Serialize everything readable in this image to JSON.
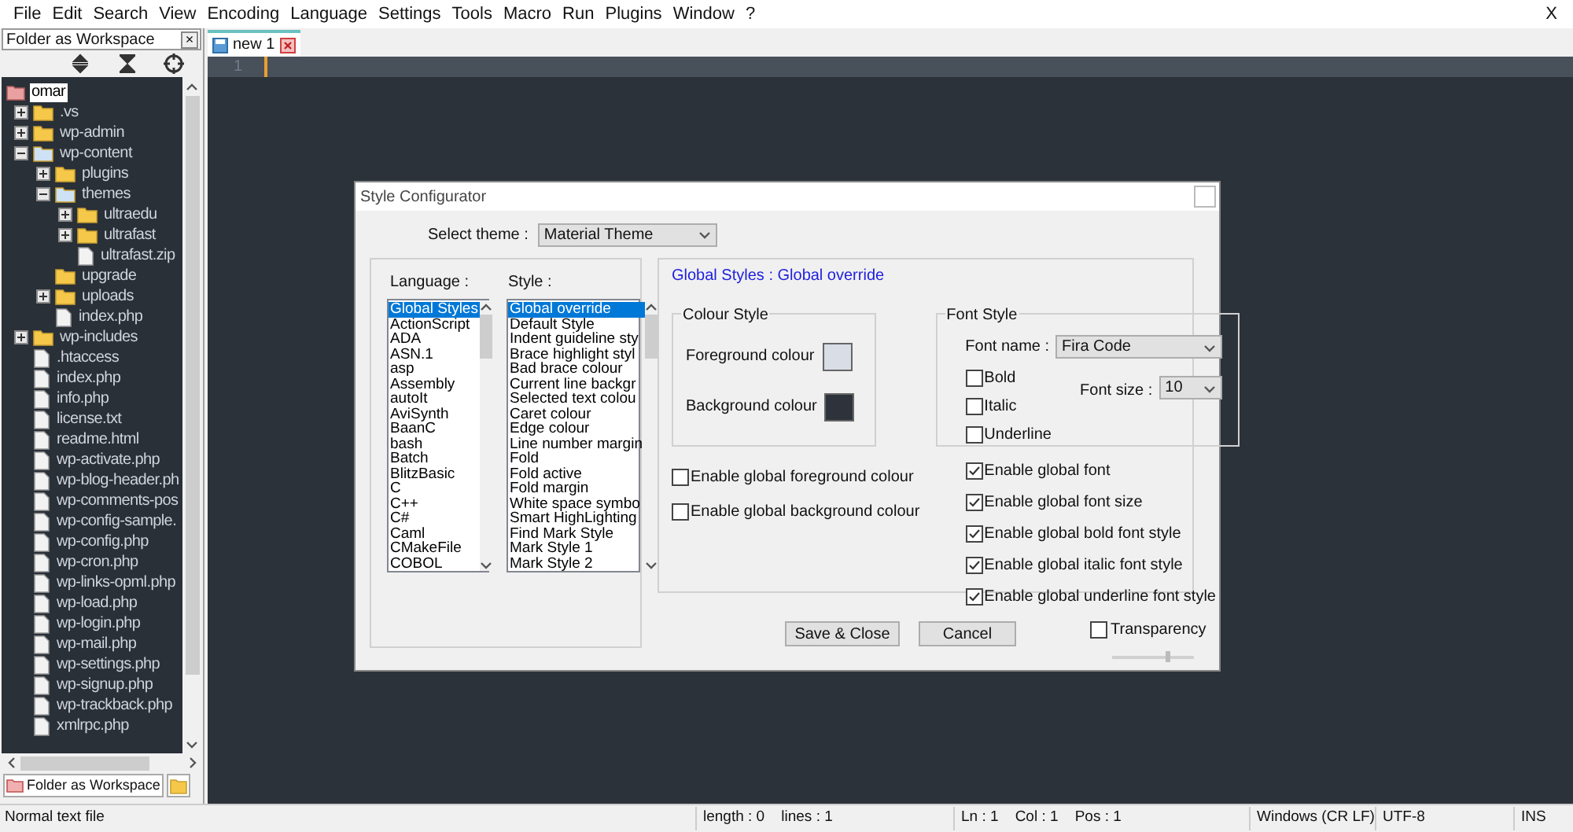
{
  "menu": [
    "File",
    "Edit",
    "Search",
    "View",
    "Encoding",
    "Language",
    "Settings",
    "Tools",
    "Macro",
    "Run",
    "Plugins",
    "Window",
    "?"
  ],
  "close_label": "X",
  "panel": {
    "title": "Folder as Workspace",
    "close": "×",
    "bottom_tab": "Folder as Workspace",
    "tree": [
      {
        "kind": "root",
        "label": "omar",
        "selected": true,
        "children": [
          {
            "kind": "folder",
            "label": ".vs",
            "expanded": false
          },
          {
            "kind": "folder",
            "label": "wp-admin",
            "expanded": false
          },
          {
            "kind": "folder",
            "label": "wp-content",
            "expanded": true,
            "children": [
              {
                "kind": "folder",
                "label": "plugins",
                "expanded": false
              },
              {
                "kind": "folder",
                "label": "themes",
                "expanded": true,
                "children": [
                  {
                    "kind": "folder",
                    "label": "ultraedu",
                    "expanded": false
                  },
                  {
                    "kind": "folder",
                    "label": "ultrafast",
                    "expanded": false
                  },
                  {
                    "kind": "file",
                    "label": "ultrafast.zip"
                  }
                ]
              },
              {
                "kind": "folder",
                "label": "upgrade"
              },
              {
                "kind": "folder",
                "label": "uploads",
                "expanded": false
              },
              {
                "kind": "file",
                "label": "index.php"
              }
            ]
          },
          {
            "kind": "folder",
            "label": "wp-includes",
            "expanded": false
          },
          {
            "kind": "file",
            "label": ".htaccess"
          },
          {
            "kind": "file",
            "label": "index.php"
          },
          {
            "kind": "file",
            "label": "info.php"
          },
          {
            "kind": "file",
            "label": "license.txt"
          },
          {
            "kind": "file",
            "label": "readme.html"
          },
          {
            "kind": "file",
            "label": "wp-activate.php"
          },
          {
            "kind": "file",
            "label": "wp-blog-header.ph"
          },
          {
            "kind": "file",
            "label": "wp-comments-pos"
          },
          {
            "kind": "file",
            "label": "wp-config-sample."
          },
          {
            "kind": "file",
            "label": "wp-config.php"
          },
          {
            "kind": "file",
            "label": "wp-cron.php"
          },
          {
            "kind": "file",
            "label": "wp-links-opml.php"
          },
          {
            "kind": "file",
            "label": "wp-load.php"
          },
          {
            "kind": "file",
            "label": "wp-login.php"
          },
          {
            "kind": "file",
            "label": "wp-mail.php"
          },
          {
            "kind": "file",
            "label": "wp-settings.php"
          },
          {
            "kind": "file",
            "label": "wp-signup.php"
          },
          {
            "kind": "file",
            "label": "wp-trackback.php"
          },
          {
            "kind": "file",
            "label": "xmlrpc.php"
          }
        ]
      }
    ]
  },
  "editor": {
    "tab": "new 1",
    "line_numbers": [
      "1"
    ]
  },
  "dialog": {
    "title": "Style Configurator",
    "theme_label": "Select theme :",
    "theme": "Material Theme",
    "language_label": "Language :",
    "style_label": "Style :",
    "languages": [
      {
        "label": "Global Styles",
        "selected": true
      },
      {
        "label": "ActionScript",
        "selected": false
      },
      {
        "label": "ADA",
        "selected": false
      },
      {
        "label": "ASN.1",
        "selected": false
      },
      {
        "label": "asp",
        "selected": false
      },
      {
        "label": "Assembly",
        "selected": false
      },
      {
        "label": "autoIt",
        "selected": false
      },
      {
        "label": "AviSynth",
        "selected": false
      },
      {
        "label": "BaanC",
        "selected": false
      },
      {
        "label": "bash",
        "selected": false
      },
      {
        "label": "Batch",
        "selected": false
      },
      {
        "label": "BlitzBasic",
        "selected": false
      },
      {
        "label": "C",
        "selected": false
      },
      {
        "label": "C++",
        "selected": false
      },
      {
        "label": "C#",
        "selected": false
      },
      {
        "label": "Caml",
        "selected": false
      },
      {
        "label": "CMakeFile",
        "selected": false
      },
      {
        "label": "COBOL",
        "selected": false
      }
    ],
    "styles": [
      {
        "label": "Global override",
        "selected": true
      },
      {
        "label": "Default Style",
        "selected": false
      },
      {
        "label": "Indent guideline sty",
        "selected": false
      },
      {
        "label": "Brace highlight styl",
        "selected": false
      },
      {
        "label": "Bad brace colour",
        "selected": false
      },
      {
        "label": "Current line backgr",
        "selected": false
      },
      {
        "label": "Selected text colou",
        "selected": false
      },
      {
        "label": "Caret colour",
        "selected": false
      },
      {
        "label": "Edge colour",
        "selected": false
      },
      {
        "label": "Line number margin",
        "selected": false
      },
      {
        "label": "Fold",
        "selected": false
      },
      {
        "label": "Fold active",
        "selected": false
      },
      {
        "label": "Fold margin",
        "selected": false
      },
      {
        "label": "White space symbo",
        "selected": false
      },
      {
        "label": "Smart HighLighting",
        "selected": false
      },
      {
        "label": "Find Mark Style",
        "selected": false
      },
      {
        "label": "Mark Style 1",
        "selected": false
      },
      {
        "label": "Mark Style 2",
        "selected": false
      }
    ],
    "heading": "Global Styles : Global override",
    "colour_group": "Colour Style",
    "colours": [
      {
        "label": "Foreground colour",
        "color": "#d8dde6"
      },
      {
        "label": "Background colour",
        "color": "#2e333b"
      }
    ],
    "colour_checks": [
      {
        "label": "Enable global foreground colour",
        "checked": false
      },
      {
        "label": "Enable global background colour",
        "checked": false
      }
    ],
    "font_group": "Font Style",
    "font_name_label": "Font name :",
    "font_name": "Fira Code",
    "font_checks": [
      {
        "label": "Bold",
        "checked": false
      },
      {
        "label": "Italic",
        "checked": false
      },
      {
        "label": "Underline",
        "checked": false
      }
    ],
    "font_size_label": "Font size :",
    "font_size": "10",
    "global_checks": [
      {
        "label": "Enable global font",
        "checked": true
      },
      {
        "label": "Enable global font size",
        "checked": true
      },
      {
        "label": "Enable global bold font style",
        "checked": true
      },
      {
        "label": "Enable global italic font style",
        "checked": true
      },
      {
        "label": "Enable global underline font style",
        "checked": true
      }
    ],
    "buttons": [
      "Save & Close",
      "Cancel"
    ],
    "transparency": {
      "label": "Transparency",
      "checked": false,
      "level": 0.7
    }
  },
  "status_bar": [
    "Normal text file",
    "length : 0    lines : 1",
    "Ln : 1    Col : 1    Pos : 1",
    "Windows (CR LF)",
    "UTF-8",
    "INS"
  ]
}
